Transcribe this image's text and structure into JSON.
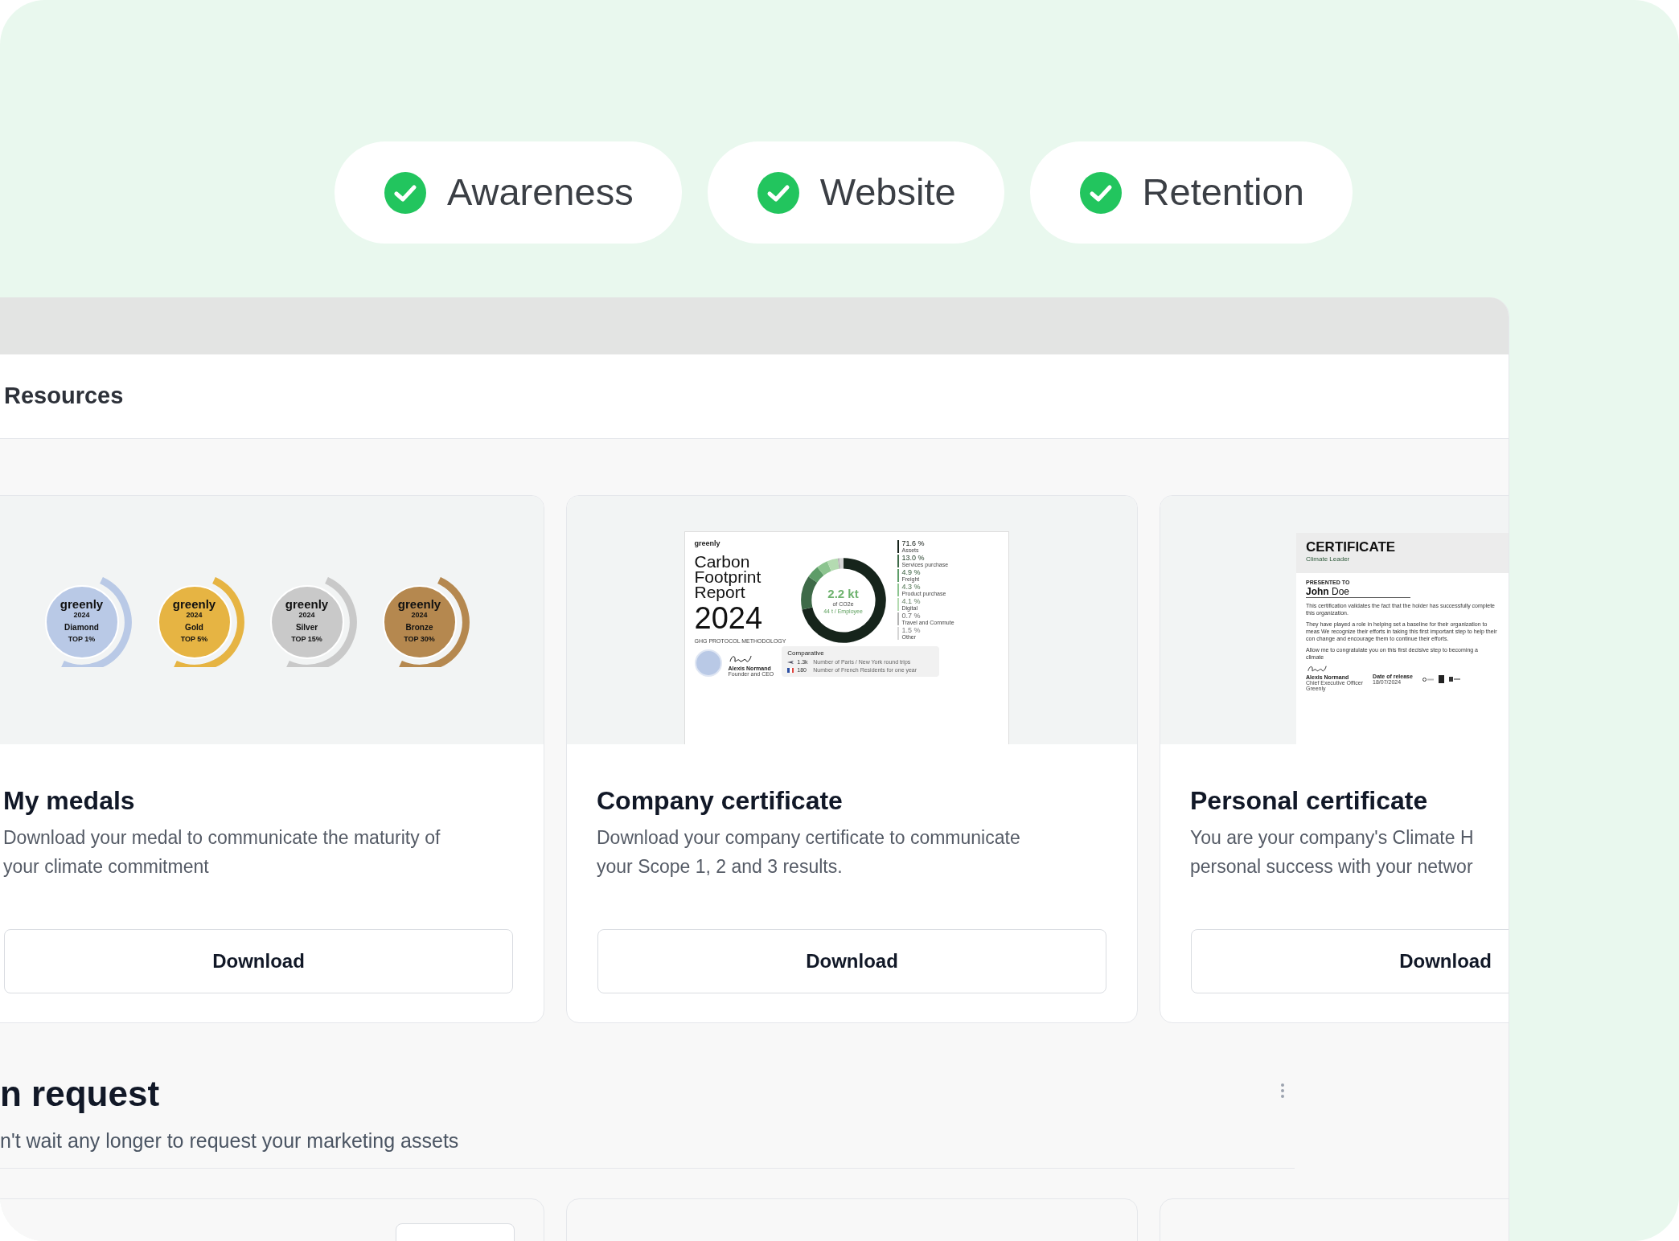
{
  "steps": [
    {
      "label": "Awareness",
      "done": true
    },
    {
      "label": "Website",
      "done": true
    },
    {
      "label": "Retention",
      "done": true
    }
  ],
  "panel": {
    "title": "Resources"
  },
  "resource_cards": [
    {
      "kind": "medals",
      "title": "My medals",
      "description_lines": [
        "Download your medal to communicate the maturity of",
        "your climate commitment"
      ],
      "button": "Download",
      "medals": [
        {
          "logo": "greenly",
          "year": "2024",
          "tier": "Diamond",
          "rank": "TOP 1%",
          "color": "#b9c9e6"
        },
        {
          "logo": "greenly",
          "year": "2024",
          "tier": "Gold",
          "rank": "TOP 5%",
          "color": "#e6b443"
        },
        {
          "logo": "greenly",
          "year": "2024",
          "tier": "Silver",
          "rank": "TOP 15%",
          "color": "#c9c9c9"
        },
        {
          "logo": "greenly",
          "year": "2024",
          "tier": "Bronze",
          "rank": "TOP 30%",
          "color": "#b5884f"
        }
      ]
    },
    {
      "kind": "company_certificate",
      "title": "Company certificate",
      "description_lines": [
        "Download your company certificate to communicate",
        "your Scope 1, 2 and 3 results."
      ],
      "button": "Download",
      "document": {
        "logo": "greenly",
        "title_lines": [
          "Carbon",
          "Footprint",
          "Report"
        ],
        "year": "2024",
        "methodology": "GHG PROTOCOL METHODOLOGY",
        "total": "2.2 kt",
        "unit": "of CO2e",
        "per_employee": "44 t / Employee",
        "breakdown": [
          {
            "pct": "71.6 %",
            "color": "#16241b"
          },
          {
            "pct": "13.0 %",
            "color": "#3e6a48"
          },
          {
            "pct": "4.9 %",
            "color": "#5d9c68"
          },
          {
            "pct": "4.3 %",
            "color": "#8cc48f"
          },
          {
            "pct": "4.1 %",
            "color": "#b4dbb1"
          },
          {
            "pct": "0.7 %",
            "color": "#b3b3b3"
          },
          {
            "pct": "1.5 %",
            "color": "#d6d6d6"
          }
        ],
        "chart_data": {
          "type": "donut",
          "categories": [
            "Assets",
            "Services purchase",
            "Freight",
            "Product purchase",
            "Digital",
            "Travel and Commute",
            "Other"
          ],
          "values": [
            71.6,
            13.0,
            4.9,
            4.3,
            4.1,
            0.7,
            1.5
          ]
        },
        "comparative": {
          "title": "Comparative",
          "rows": [
            {
              "kind": "plane",
              "value": "1.3k",
              "label": "Number of Paris / New York round trips"
            },
            {
              "kind": "flag",
              "value": "180",
              "label": "Number of French Residents for one year"
            }
          ]
        },
        "signer": "Alexis Normand",
        "signer_role": "Founder and CEO"
      }
    },
    {
      "kind": "personal_certificate",
      "title": "Personal certificate",
      "description_lines": [
        "You are your company's Climate H",
        "personal success with your networ"
      ],
      "button": "Download",
      "document": {
        "heading": "CERTIFICATE",
        "subheading": "Climate Leader",
        "presented_label": "PRESENTED TO",
        "name": "**John** Doe",
        "paragraphs": [
          "This certification validates the fact that the holder has successfully complete this organization.",
          "They have played a role in helping set a baseline for their organization to meas We recognize their efforts in taking this first important step to help their con change and encourage them to continue their efforts.",
          "Allow me to congratulate you on this first decisive step to becoming a climate"
        ],
        "signer": "Alexis Normand",
        "signer_role": "Chief Executive Officer",
        "signer_company": "Greenly",
        "release_label": "Date of release",
        "release_date": "18/07/2024"
      }
    }
  ],
  "request_section": {
    "title": "n request",
    "subtitle": "n't wait any longer to request your marketing assets"
  }
}
